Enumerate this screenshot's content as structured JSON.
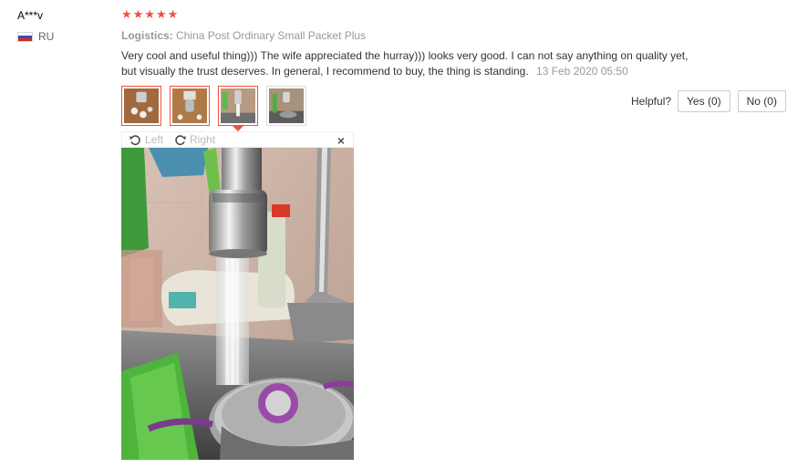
{
  "reviewer": {
    "name": "A***v",
    "country": "RU"
  },
  "rating": {
    "stars": 5,
    "max": 5
  },
  "logistics": {
    "label": "Logistics:",
    "value": "China Post Ordinary Small Packet Plus"
  },
  "review": {
    "text": "Very cool and useful thing))) The wife appreciated the hurray))) looks very good. I can not say anything on quality yet, but visually the trust deserves. In general, I recommend to buy, the thing is standing.",
    "date": "13 Feb 2020 05:50"
  },
  "helpful": {
    "label": "Helpful?",
    "yes": "Yes (0)",
    "no": "No (0)"
  },
  "viewer": {
    "left_label": "Left",
    "right_label": "Right",
    "close_label": "×"
  },
  "thumbnails": {
    "count": 4,
    "selected_index": 2
  },
  "colors": {
    "star": "#f0523f",
    "accent": "#f0523f"
  }
}
